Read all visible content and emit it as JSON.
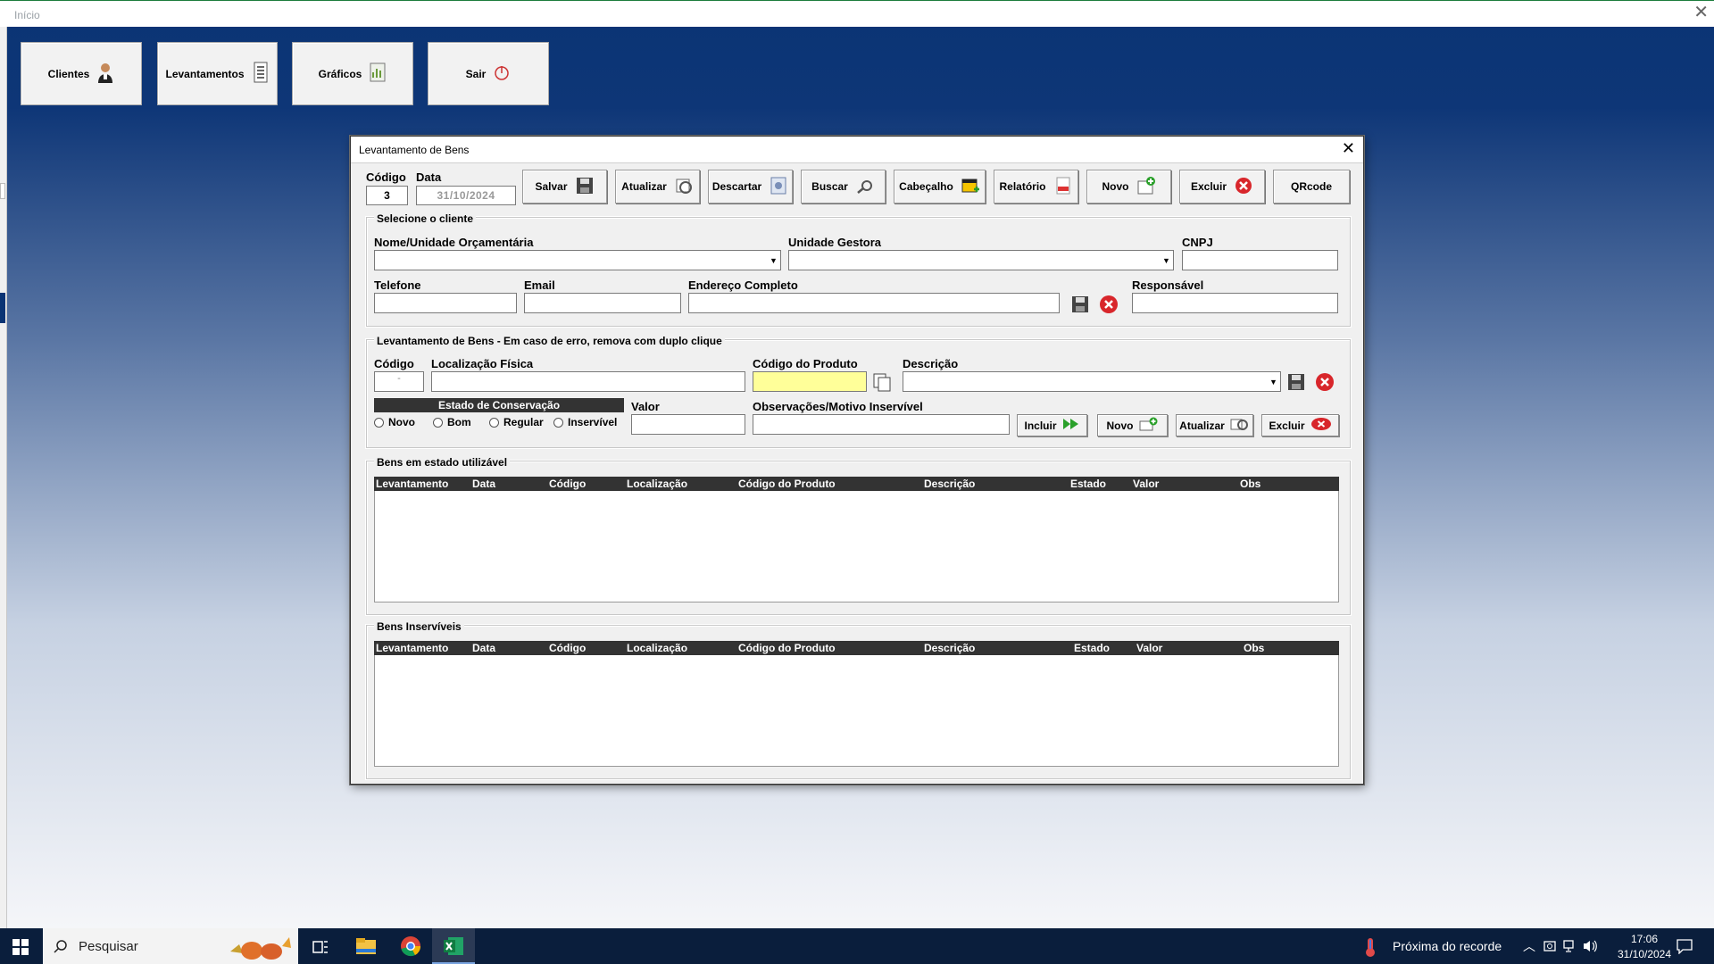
{
  "window": {
    "title": "Início"
  },
  "main_menu": [
    {
      "label": "Clientes",
      "icon": "user-icon"
    },
    {
      "label": "Levantamentos",
      "icon": "document-icon"
    },
    {
      "label": "Gráficos",
      "icon": "chart-icon"
    },
    {
      "label": "Sair",
      "icon": "power-icon"
    }
  ],
  "dialog": {
    "title": "Levantamento de Bens",
    "codigo_label": "Código",
    "codigo_value": "3",
    "data_label": "Data",
    "data_value": "31/10/2024",
    "toolbar": [
      {
        "label": "Salvar",
        "icon": "save-icon"
      },
      {
        "label": "Atualizar",
        "icon": "refresh-icon"
      },
      {
        "label": "Descartar",
        "icon": "discard-icon"
      },
      {
        "label": "Buscar",
        "icon": "search-icon"
      },
      {
        "label": "Cabeçalho",
        "icon": "header-icon"
      },
      {
        "label": "Relatório",
        "icon": "pdf-icon"
      },
      {
        "label": "Novo",
        "icon": "new-icon"
      },
      {
        "label": "Excluir",
        "icon": "delete-icon"
      },
      {
        "label": "QRcode",
        "icon": ""
      }
    ],
    "client_section": {
      "title": "Selecione o cliente",
      "nome_label": "Nome/Unidade Orçamentária",
      "unidade_label": "Unidade Gestora",
      "cnpj_label": "CNPJ",
      "telefone_label": "Telefone",
      "email_label": "Email",
      "endereco_label": "Endereço Completo",
      "responsavel_label": "Responsável"
    },
    "bens_section": {
      "title": "Levantamento de Bens - Em caso de erro, remova com duplo clique",
      "codigo_label": "Código",
      "codigo_value": "-",
      "localizacao_label": "Localização Física",
      "codigo_produto_label": "Código do Produto",
      "descricao_label": "Descrição",
      "estado_label": "Estado de Conservação",
      "estado_options": [
        "Novo",
        "Bom",
        "Regular",
        "Inservível"
      ],
      "valor_label": "Valor",
      "obs_label": "Observações/Motivo Inservível",
      "buttons": [
        "Incluir",
        "Novo",
        "Atualizar",
        "Excluir"
      ]
    },
    "utilizavel_section": {
      "title": "Bens em estado utilizável",
      "columns": [
        "Levantamento",
        "Data",
        "Código",
        "Localização",
        "Código do Produto",
        "Descrição",
        "Estado",
        "Valor",
        "Obs"
      ]
    },
    "inserviveis_section": {
      "title": "Bens Inservíveis",
      "columns": [
        "Levantamento",
        "Data",
        "Código",
        "Localização",
        "Código do Produto",
        "Descrição",
        "Estado",
        "Valor",
        "Obs"
      ]
    }
  },
  "taskbar": {
    "search_placeholder": "Pesquisar",
    "weather_text": "Próxima do recorde",
    "time": "17:06",
    "date": "31/10/2024"
  }
}
